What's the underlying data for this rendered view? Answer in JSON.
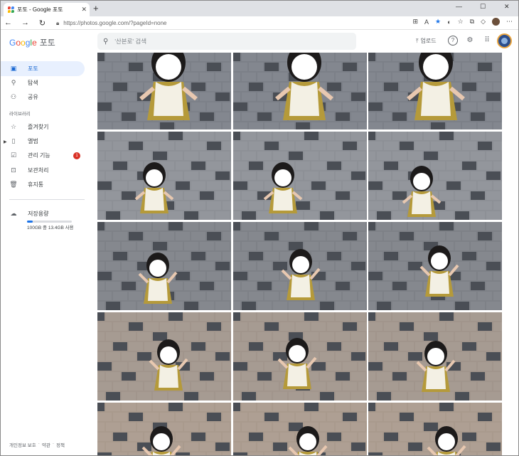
{
  "browser": {
    "tab_title": "포토 - Google 포토",
    "new_tab": "+",
    "url": "https://photos.google.com/?pageId=none",
    "win_min": "—",
    "win_max": "☐",
    "win_close": "✕"
  },
  "app": {
    "logo_google": "Google",
    "logo_product": "포토",
    "search_placeholder": "'산본로' 검색",
    "upload_label": "업로드"
  },
  "sidebar": {
    "items": [
      {
        "label": "포토",
        "icon": "photo-icon"
      },
      {
        "label": "탐색",
        "icon": "search-icon"
      },
      {
        "label": "공유",
        "icon": "people-icon"
      }
    ],
    "library_label": "라이브러리",
    "library_items": [
      {
        "label": "즐겨찾기",
        "icon": "star-icon"
      },
      {
        "label": "앨범",
        "icon": "album-icon"
      },
      {
        "label": "관리 기능",
        "icon": "checklist-icon",
        "badge": "1"
      },
      {
        "label": "보관처리",
        "icon": "archive-icon"
      },
      {
        "label": "휴지통",
        "icon": "trash-icon"
      }
    ],
    "storage_label": "저장용량",
    "storage_text": "100GB 중 13.4GB 사용",
    "storage_fraction": 0.134,
    "footer": [
      "개인정보 보호",
      "약관",
      "정책"
    ],
    "footer_sep": "·"
  },
  "colors": {
    "accent": "#1a73e8",
    "active_bg": "#e8f0fe",
    "badge": "#d93025"
  }
}
